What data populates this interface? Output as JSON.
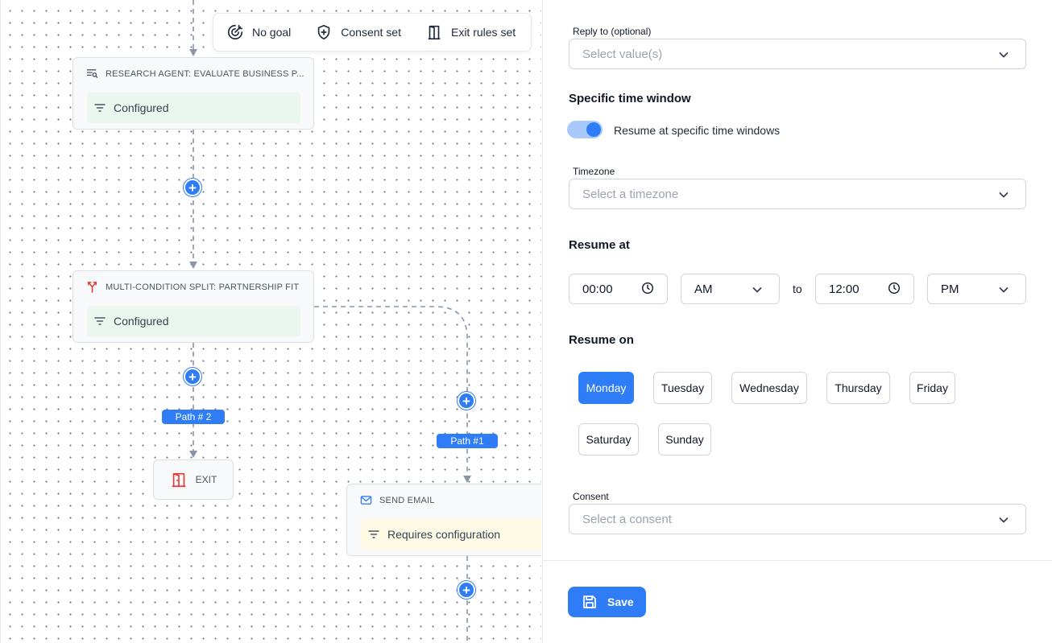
{
  "toolbar": {
    "goal_label": "No goal",
    "consent_label": "Consent set",
    "exit_rules_label": "Exit rules set"
  },
  "nodes": {
    "research_agent": {
      "title": "RESEARCH AGENT: EVALUATE BUSINESS P...",
      "status": "Configured"
    },
    "multi_split": {
      "title": "MULTI-CONDITION SPLIT: PARTNERSHIP FIT",
      "status": "Configured"
    },
    "exit": {
      "label": "EXIT"
    },
    "send_email": {
      "title": "SEND EMAIL",
      "status": "Requires configuration"
    }
  },
  "paths": {
    "path2": "Path # 2",
    "path1": "Path #1"
  },
  "form": {
    "reply_to": {
      "label": "Reply to (optional)",
      "placeholder": "Select value(s)"
    },
    "time_window": {
      "title": "Specific time window",
      "toggle_label": "Resume at specific time windows",
      "enabled": true
    },
    "timezone": {
      "label": "Timezone",
      "placeholder": "Select a timezone"
    },
    "resume_at": {
      "title": "Resume at",
      "start_time": "00:00",
      "start_period": "AM",
      "to_label": "to",
      "end_time": "12:00",
      "end_period": "PM"
    },
    "resume_on": {
      "title": "Resume on",
      "days": [
        "Monday",
        "Tuesday",
        "Wednesday",
        "Thursday",
        "Friday",
        "Saturday",
        "Sunday"
      ],
      "selected": "Monday"
    },
    "consent": {
      "label": "Consent",
      "placeholder": "Select a consent"
    },
    "save_label": "Save"
  },
  "colors": {
    "accent": "#2f7df6",
    "configured_bg": "#eaf7ee",
    "warning_bg": "#fdfbe6",
    "split_icon": "#e53935"
  }
}
